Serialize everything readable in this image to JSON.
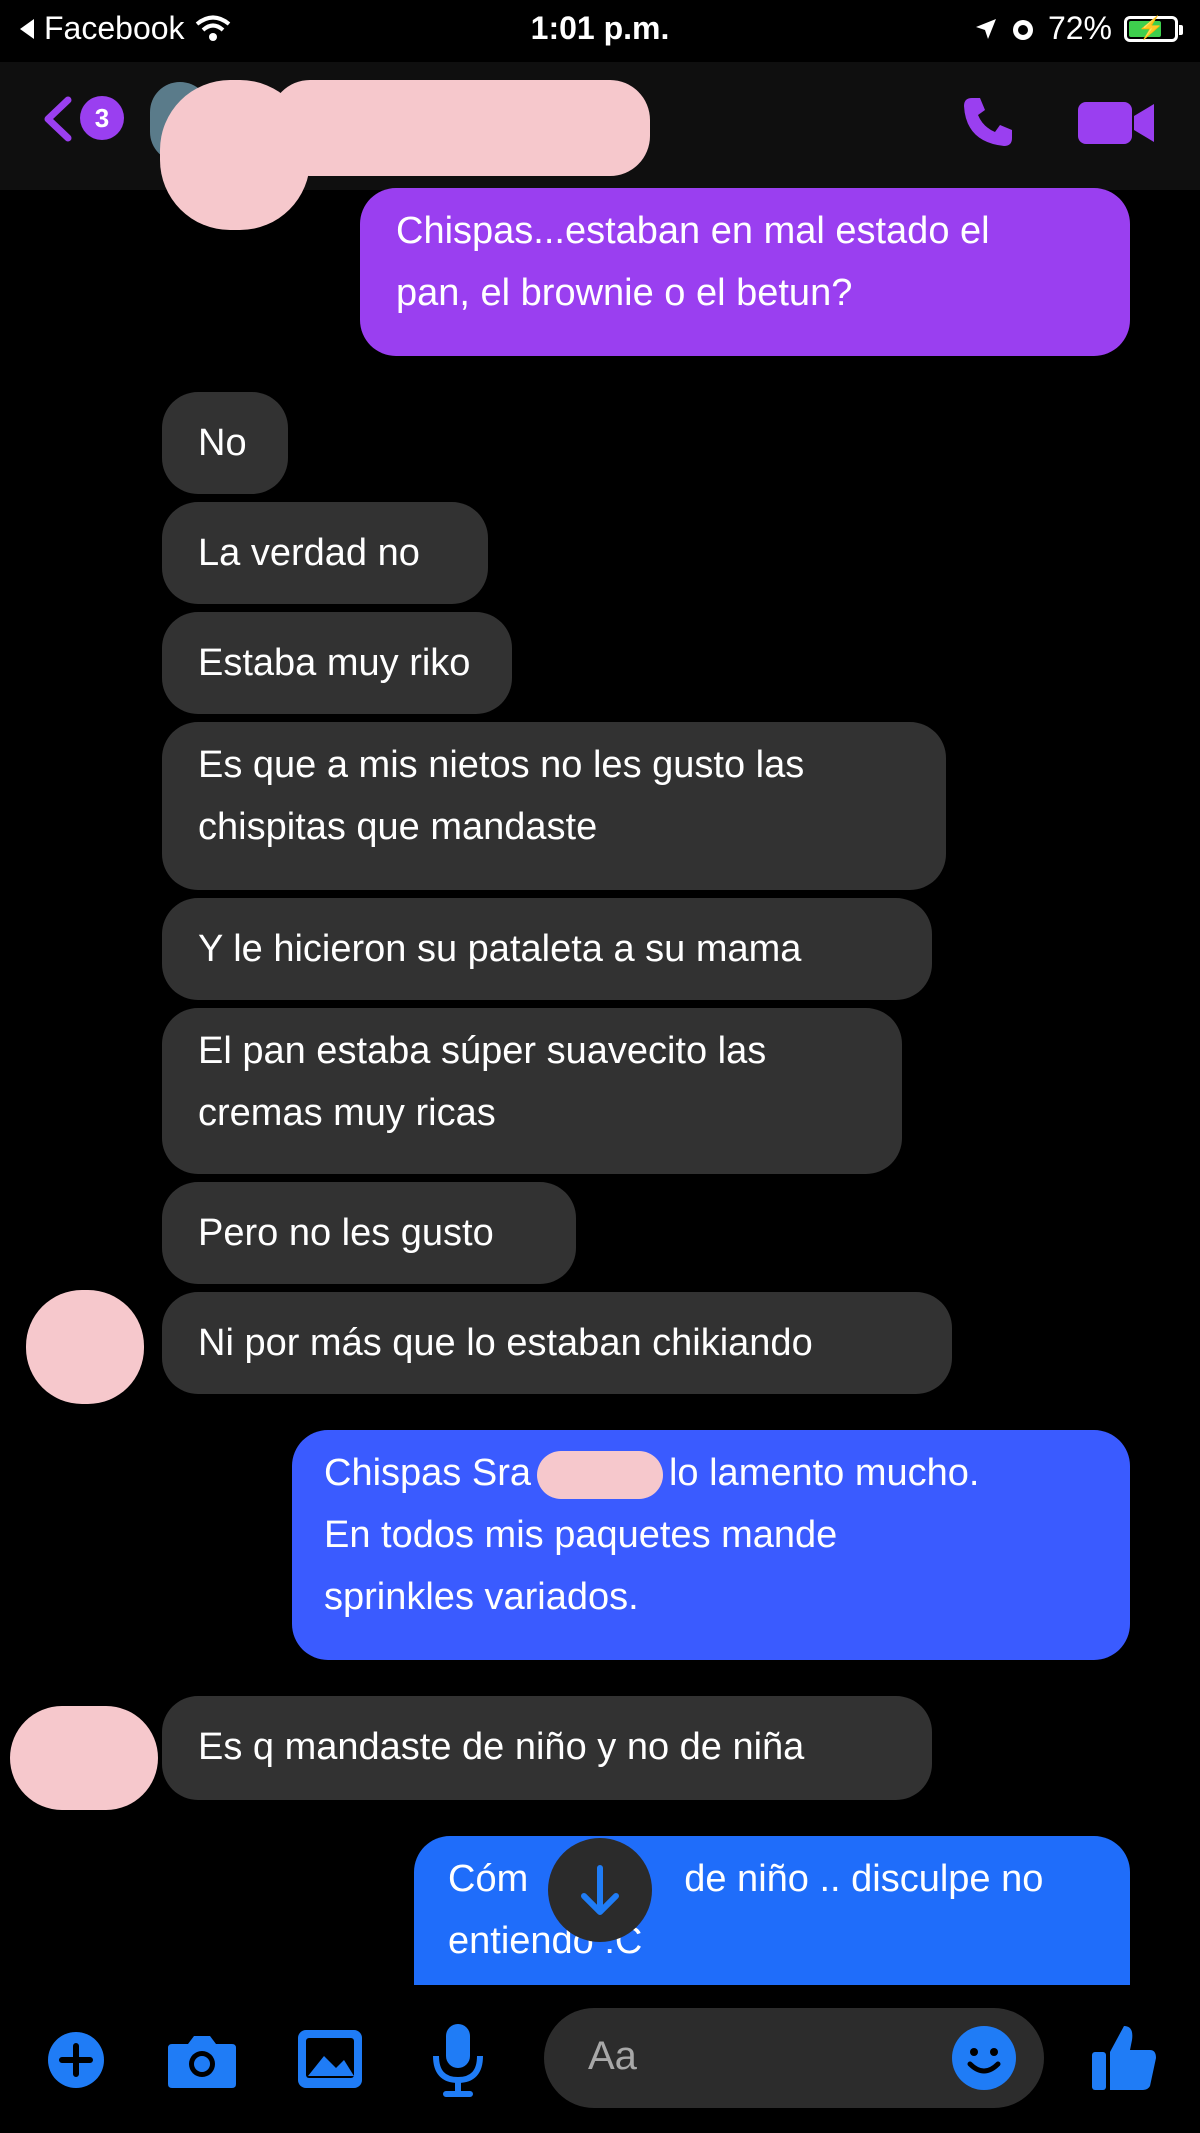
{
  "status_bar": {
    "back_app": "Facebook",
    "time": "1:01 p.m.",
    "battery": "72%",
    "battery_level": 0.72
  },
  "header": {
    "unread_badge": "3",
    "icons": [
      "chevron-left-icon",
      "phone-icon",
      "video-camera-icon"
    ],
    "accent": "#9a3ff0"
  },
  "messages": [
    {
      "side": "out",
      "text_lines": [
        "Chispas...estaban en mal estado el",
        "pan, el brownie o el betun?"
      ],
      "color": "#9a3ff0"
    },
    {
      "side": "in",
      "text_lines": [
        "No"
      ]
    },
    {
      "side": "in",
      "text_lines": [
        "La verdad no"
      ]
    },
    {
      "side": "in",
      "text_lines": [
        "Estaba muy riko"
      ]
    },
    {
      "side": "in",
      "text_lines": [
        "Es que a mis nietos no les gusto las",
        "chispitas que mandaste"
      ]
    },
    {
      "side": "in",
      "text_lines": [
        "Y le hicieron su pataleta a su mama"
      ]
    },
    {
      "side": "in",
      "text_lines": [
        "El pan estaba súper suavecito las",
        "cremas muy ricas"
      ]
    },
    {
      "side": "in",
      "text_lines": [
        "Pero no les gusto"
      ]
    },
    {
      "side": "in",
      "text_lines": [
        "Ni por más que lo estaban chikiando"
      ]
    },
    {
      "side": "out",
      "text_lines": [
        "Chispas Sra",
        "lo lamento mucho.",
        "En todos mis paquetes mande",
        "sprinkles variados."
      ],
      "color": "#3a5bff"
    },
    {
      "side": "in",
      "text_lines": [
        "Es q mandaste de niño y no de niña"
      ]
    },
    {
      "side": "out",
      "text_lines": [
        "Cóm",
        "de niño .. disculpe no",
        "entiendo :C"
      ],
      "color": "#1f6dfa"
    }
  ],
  "composer": {
    "placeholder": "Aa",
    "icons": [
      "plus-icon",
      "camera-icon",
      "image-icon",
      "microphone-icon",
      "emoji-icon",
      "thumbs-up-icon"
    ],
    "icon_color": "#1f7cf6"
  }
}
